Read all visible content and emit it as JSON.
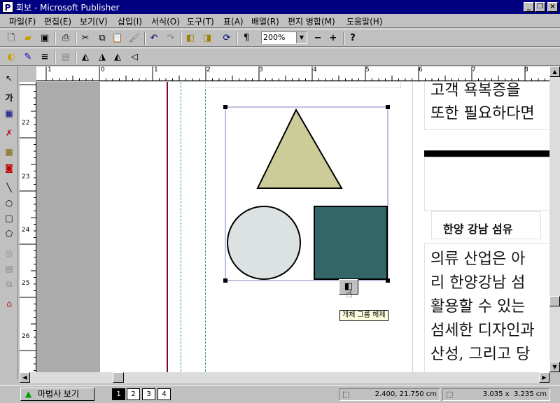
{
  "window": {
    "title": "회보 - Microsoft Publisher",
    "app_icon": "P"
  },
  "menu": [
    "파일(F)",
    "편집(E)",
    "보기(V)",
    "삽입(I)",
    "서식(O)",
    "도구(T)",
    "표(A)",
    "배열(R)",
    "편지 병합(M)",
    "도움말(H)"
  ],
  "toolbar": {
    "zoom": "200%"
  },
  "ruler": {
    "h_labels": [
      "1",
      "0",
      "1",
      "2",
      "3",
      "4",
      "5",
      "6",
      "7",
      "8"
    ],
    "v_labels": [
      "22",
      "23",
      "24",
      "25",
      "26"
    ]
  },
  "document": {
    "top_lines": [
      "고객 욕복증을 ",
      "또한 필요하다면"
    ],
    "heading": "한양 강남 섬유",
    "body_lines": [
      "의류 산업은 아",
      "리 한양강남 섬",
      "활용할 수 있는",
      "섬세한 디자인과",
      "산성, 그리고 당"
    ],
    "shape_colors": {
      "triangle": "#cccc99",
      "circle": "#dce2e2",
      "square": "#336666"
    },
    "tooltip": "개체 그룹 해제"
  },
  "status": {
    "wizard_button": "마법사 보기",
    "pages": [
      "1",
      "2",
      "3",
      "4"
    ],
    "active_page": "1",
    "position": "2.400, 21.750 cm",
    "size": "3.035 x  3.235 cm"
  }
}
